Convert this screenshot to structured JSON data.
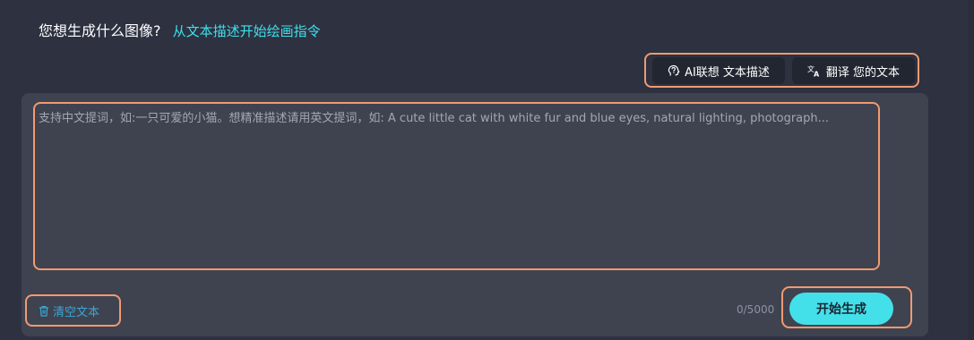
{
  "header": {
    "question": "您想生成什么图像?",
    "hint_link": "从文本描述开始绘画指令"
  },
  "toolbar": {
    "ai_expand_label": "AI联想 文本描述",
    "ai_expand_icon": "brain-head-icon",
    "translate_label": "翻译 您的文本",
    "translate_icon": "translate-icon"
  },
  "prompt": {
    "value": "",
    "placeholder": "支持中文提词，如:一只可爱的小猫。想精准描述请用英文提词，如: A cute little cat with white fur and blue eyes, natural lighting, photograph..."
  },
  "footer": {
    "clear_label": "清空文本",
    "clear_icon": "trash-icon",
    "char_count": "0/5000",
    "generate_label": "开始生成"
  },
  "colors": {
    "background": "#2d3140",
    "panel": "#3f4350",
    "accent": "#44e0ea",
    "link": "#3fe0ec",
    "highlight_border": "#f19a71"
  }
}
